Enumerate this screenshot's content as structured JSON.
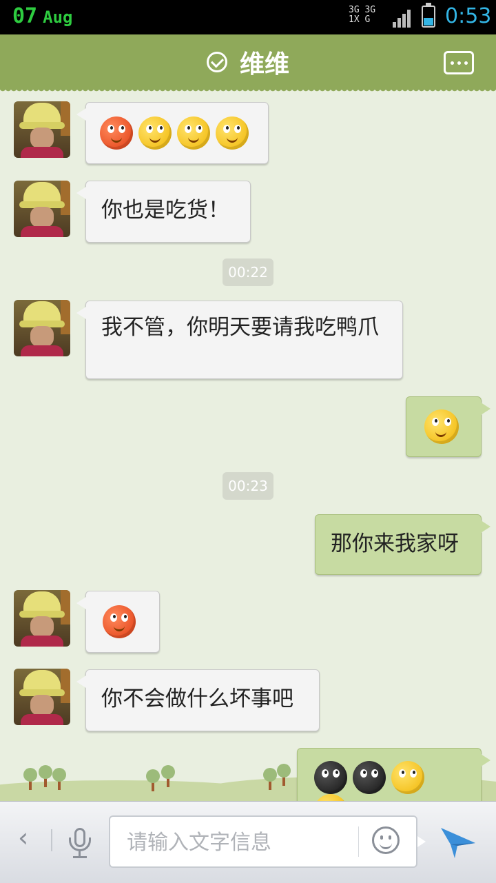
{
  "status_bar": {
    "day": "07",
    "month": "Aug",
    "network_top": "3G 3G 1X G",
    "time": "0:53"
  },
  "header": {
    "title": "维维",
    "status_icon": "check-circle-icon",
    "more_icon": "chat-more-icon"
  },
  "messages": [
    {
      "type": "incoming",
      "kind": "emoji",
      "emojis": [
        "angry-fire-emoji",
        "confused-emoji",
        "confused-emoji",
        "confused-emoji"
      ]
    },
    {
      "type": "incoming",
      "kind": "text",
      "text": "你也是吃货！"
    },
    {
      "type": "timestamp",
      "text": "00:22"
    },
    {
      "type": "incoming",
      "kind": "text",
      "text": "我不管，你明天要请我吃鸭爪"
    },
    {
      "type": "outgoing",
      "kind": "emoji",
      "emojis": [
        "shy-hand-emoji"
      ]
    },
    {
      "type": "timestamp",
      "text": "00:23"
    },
    {
      "type": "outgoing",
      "kind": "text",
      "text": "那你来我家呀"
    },
    {
      "type": "incoming",
      "kind": "emoji",
      "emojis": [
        "red-eye-roll-emoji"
      ]
    },
    {
      "type": "incoming",
      "kind": "text",
      "text": "你不会做什么坏事吧"
    },
    {
      "type": "outgoing",
      "kind": "emoji",
      "emojis": [
        "black-crying-emoji",
        "black-crying-emoji",
        "shocked-emoji",
        "shocked-emoji"
      ]
    }
  ],
  "input_bar": {
    "back_label": "‹",
    "placeholder": "请输入文字信息",
    "value": ""
  },
  "colors": {
    "header_bg": "#8fa95a",
    "chat_bg": "#e9efe0",
    "incoming_bubble": "#f4f4f4",
    "outgoing_bubble": "#c7dba2",
    "time_accent": "#33b5e5",
    "send_icon": "#3b8fd9"
  }
}
